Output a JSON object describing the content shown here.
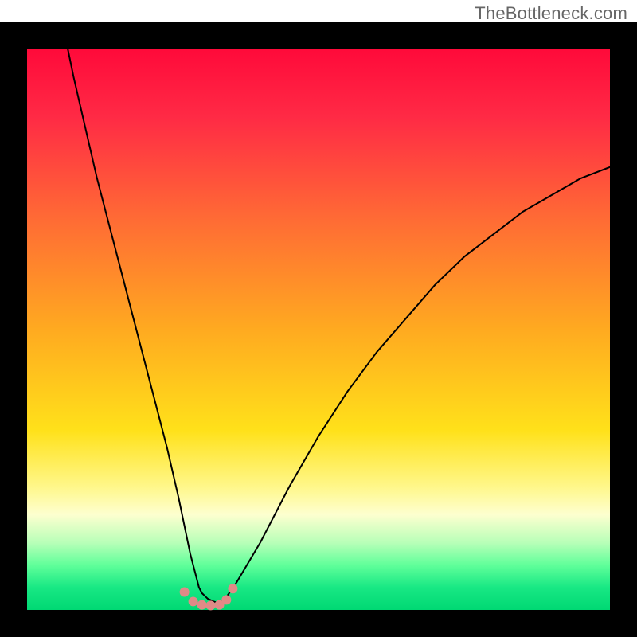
{
  "watermark": "TheBottleneck.com",
  "chart_data": {
    "type": "line",
    "title": "",
    "xlabel": "",
    "ylabel": "",
    "xlim": [
      0,
      100
    ],
    "ylim": [
      0,
      100
    ],
    "background": {
      "type": "vertical-gradient",
      "stops": [
        {
          "offset": 0.0,
          "color": "#ff0a3a"
        },
        {
          "offset": 0.12,
          "color": "#ff2a45"
        },
        {
          "offset": 0.3,
          "color": "#ff6a35"
        },
        {
          "offset": 0.5,
          "color": "#ffaa20"
        },
        {
          "offset": 0.68,
          "color": "#ffe11a"
        },
        {
          "offset": 0.78,
          "color": "#fff78a"
        },
        {
          "offset": 0.83,
          "color": "#fdffcf"
        },
        {
          "offset": 0.88,
          "color": "#b8ffb8"
        },
        {
          "offset": 0.92,
          "color": "#60ff9a"
        },
        {
          "offset": 0.96,
          "color": "#18e884"
        },
        {
          "offset": 1.0,
          "color": "#00d873"
        }
      ]
    },
    "frame_color": "#000000",
    "series": [
      {
        "name": "curve",
        "color": "#000000",
        "stroke_width": 2,
        "x": [
          7,
          8,
          10,
          12,
          14,
          16,
          18,
          20,
          22,
          24,
          26,
          27,
          28,
          29,
          29.5,
          30,
          31,
          32,
          33,
          34,
          36,
          40,
          45,
          50,
          55,
          60,
          65,
          70,
          75,
          80,
          85,
          90,
          95,
          100
        ],
        "y": [
          100,
          95,
          86,
          77,
          69,
          61,
          53,
          45,
          37,
          29,
          20,
          15,
          10,
          6,
          4,
          3,
          2,
          1.5,
          1.2,
          2,
          5,
          12,
          22,
          31,
          39,
          46,
          52,
          58,
          63,
          67,
          71,
          74,
          77,
          79
        ]
      }
    ],
    "points": {
      "name": "bottom-markers",
      "color": "#e08a87",
      "radius": 6,
      "x": [
        27.0,
        28.5,
        30.0,
        31.5,
        33.0,
        34.2,
        35.3
      ],
      "y": [
        3.2,
        1.5,
        0.9,
        0.8,
        0.9,
        1.8,
        3.8
      ]
    }
  }
}
